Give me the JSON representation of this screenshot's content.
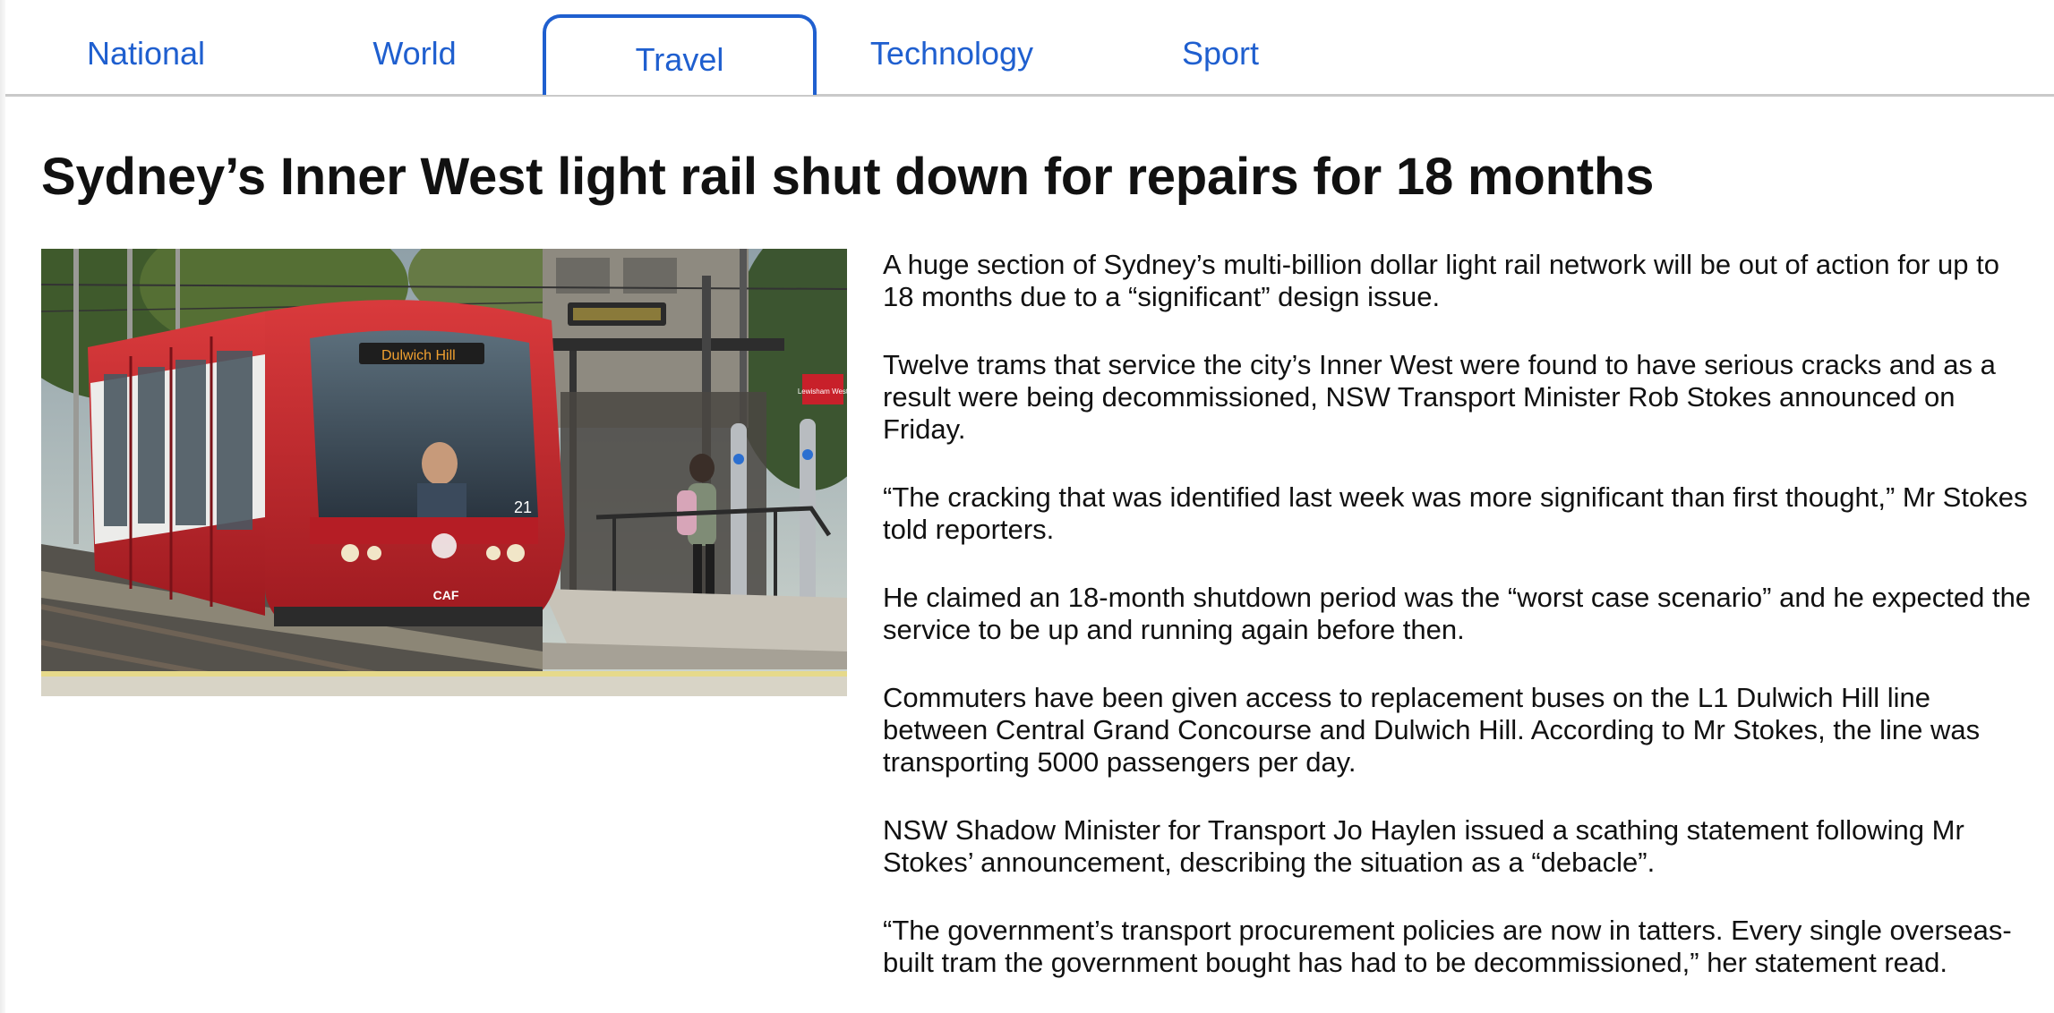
{
  "nav": {
    "tabs": [
      {
        "label": "National",
        "active": false
      },
      {
        "label": "World",
        "active": false
      },
      {
        "label": "Travel",
        "active": true
      },
      {
        "label": "Technology",
        "active": false
      },
      {
        "label": "Sport",
        "active": false
      }
    ]
  },
  "article": {
    "headline": "Sydney’s Inner West light rail shut down for repairs for 18 months",
    "image": {
      "tram_destination": "Dulwich Hill",
      "tram_number": "21",
      "station_sign": "Lewisham West",
      "maker_badge": "CAF"
    },
    "paragraphs": [
      "A huge section of Sydney’s multi-billion dollar light rail network will be out of action for up to 18 months due to a “significant” design issue.",
      "Twelve trams that service the city’s Inner West were found to have serious cracks and as a result were being decommissioned, NSW Transport Minister Rob Stokes announced on Friday.",
      "“The cracking that was identified last week was more significant than first thought,” Mr Stokes told reporters.",
      "He claimed an 18-month shutdown period was the “worst case scenario” and he expected the service to be up and running again before then.",
      "Commuters have been given access to replacement buses on the L1 Dulwich Hill line between Central Grand Concourse and Dulwich Hill. According to Mr Stokes, the line was transporting 5000 passengers per day.",
      "NSW Shadow Minister for Transport Jo Haylen issued a scathing statement following Mr Stokes’ announcement, describing the situation as a “debacle”.",
      "“The government’s transport procurement policies are now in tatters. Every single overseas-built tram the government bought has had to be decommissioned,” her statement read."
    ]
  },
  "colors": {
    "accent": "#1f5fcf",
    "tab_border": "#1f5fcf",
    "divider": "#c9c9c9",
    "tram_red": "#c8202a"
  }
}
